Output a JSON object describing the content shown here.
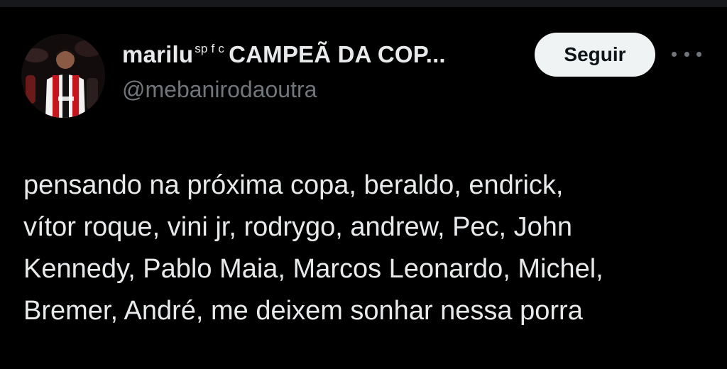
{
  "user": {
    "display_name_start": "marilu",
    "display_name_sup": "sp f c",
    "display_name_end": "CAMPEÃ DA COP...",
    "handle": "@mebanirodaoutra",
    "avatar_icon": "avatar-photo"
  },
  "actions": {
    "follow_label": "Seguir",
    "more_icon": "more-horizontal-icon"
  },
  "tweet": {
    "lines": [
      "pensando na próxima copa, beraldo, endrick,",
      "vítor roque, vini jr, rodrygo, andrew, Pec, John",
      "Kennedy, Pablo Maia, Marcos Leonardo, Michel,",
      "Bremer, André, me deixem sonhar nessa porra"
    ]
  },
  "colors": {
    "background": "#000000",
    "text_primary": "#e7e9ea",
    "text_secondary": "#71767b",
    "button_bg": "#eff3f4",
    "button_text": "#0f1419"
  }
}
